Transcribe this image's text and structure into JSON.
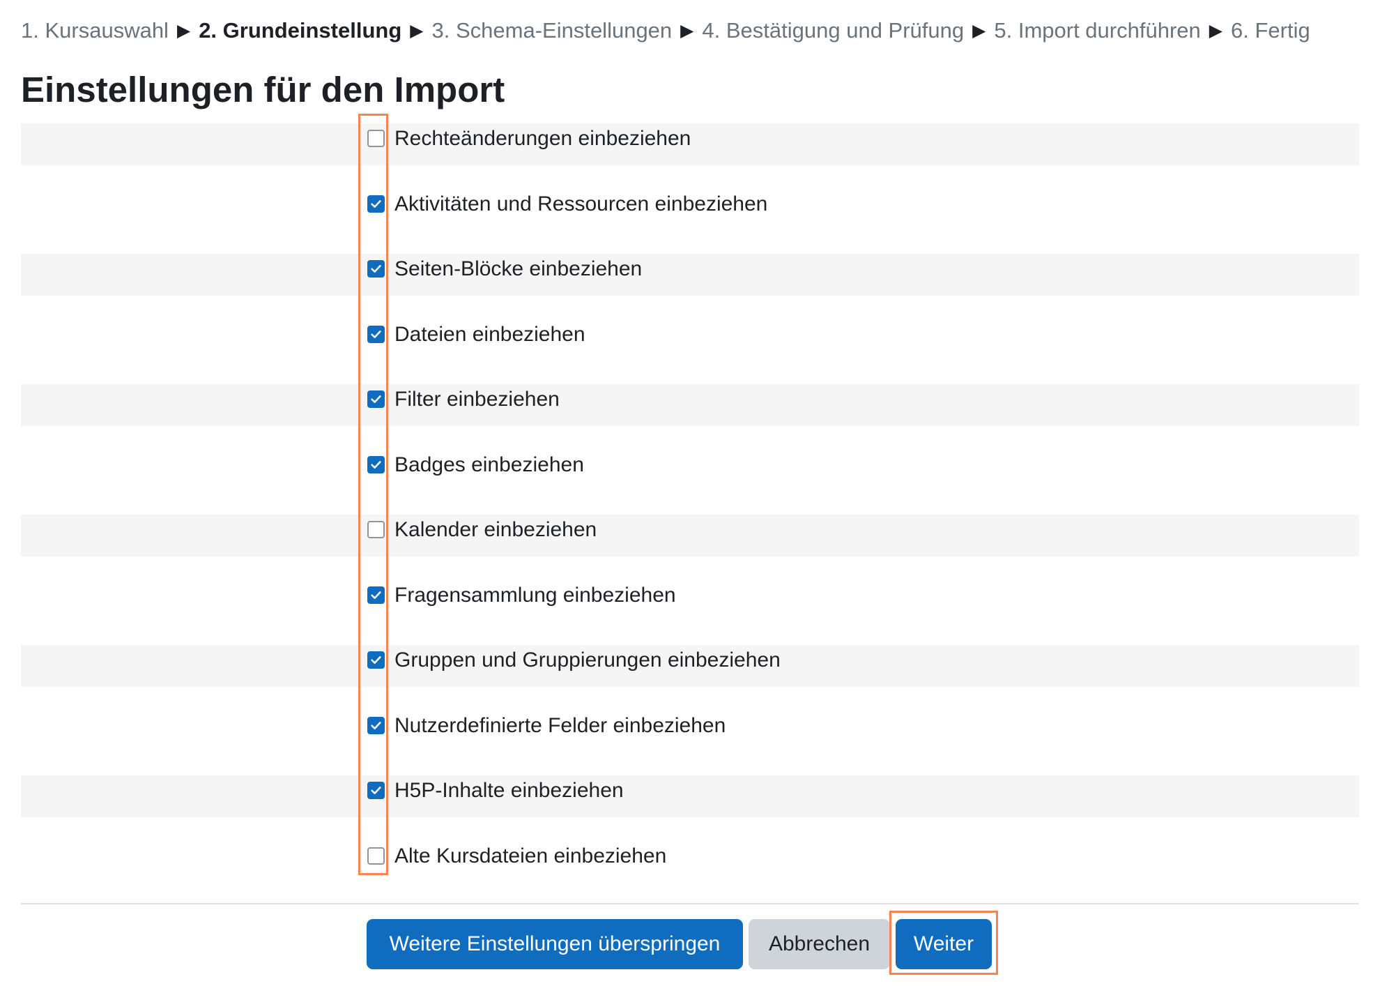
{
  "stepper": {
    "steps": [
      {
        "label": "1. Kursauswahl",
        "active": false
      },
      {
        "label": "2. Grundeinstellung",
        "active": true
      },
      {
        "label": "3. Schema-Einstellungen",
        "active": false
      },
      {
        "label": "4. Bestätigung und Prüfung",
        "active": false
      },
      {
        "label": "5. Import durchführen",
        "active": false
      },
      {
        "label": "6. Fertig",
        "active": false
      }
    ],
    "separator": "▶"
  },
  "page_title": "Einstellungen für den Import",
  "settings": [
    {
      "label": "Rechteänderungen einbeziehen",
      "checked": false
    },
    {
      "label": "Aktivitäten und Ressourcen einbeziehen",
      "checked": true
    },
    {
      "label": "Seiten-Blöcke einbeziehen",
      "checked": true
    },
    {
      "label": "Dateien einbeziehen",
      "checked": true
    },
    {
      "label": "Filter einbeziehen",
      "checked": true
    },
    {
      "label": "Badges einbeziehen",
      "checked": true
    },
    {
      "label": "Kalender einbeziehen",
      "checked": false
    },
    {
      "label": "Fragensammlung einbeziehen",
      "checked": true
    },
    {
      "label": "Gruppen und Gruppierungen einbeziehen",
      "checked": true
    },
    {
      "label": "Nutzerdefinierte Felder einbeziehen",
      "checked": true
    },
    {
      "label": "H5P-Inhalte einbeziehen",
      "checked": true
    },
    {
      "label": "Alte Kursdateien einbeziehen",
      "checked": false
    }
  ],
  "buttons": {
    "skip_label": "Weitere Einstellungen überspringen",
    "cancel_label": "Abbrechen",
    "next_label": "Weiter"
  },
  "colors": {
    "primary": "#0f6cbf",
    "secondary": "#ced4da",
    "highlight": "#f4874f",
    "row_shade": "#f5f5f5"
  }
}
